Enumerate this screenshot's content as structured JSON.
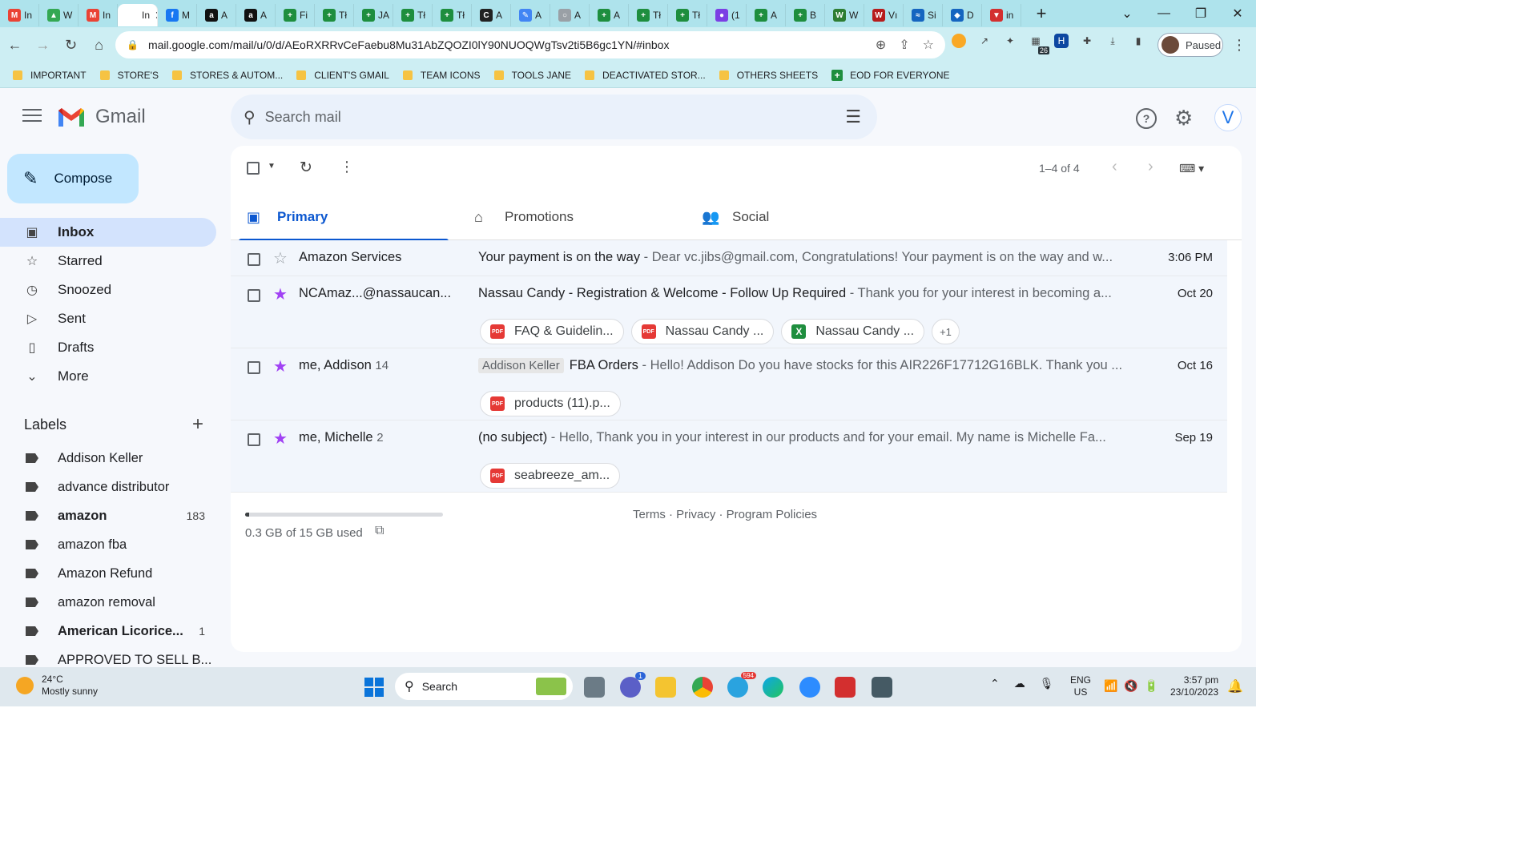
{
  "browser": {
    "tabs": [
      {
        "label": "In",
        "color": "#ea4335",
        "glyph": "M"
      },
      {
        "label": "W",
        "color": "#34a853",
        "glyph": "▲"
      },
      {
        "label": "In",
        "color": "#ea4335",
        "glyph": "M"
      },
      {
        "label": "In",
        "color": "#ffffff",
        "glyph": ""
      },
      {
        "label": "M",
        "color": "#1877f2",
        "glyph": "f"
      },
      {
        "label": "A",
        "color": "#111111",
        "glyph": "a"
      },
      {
        "label": "A",
        "color": "#111111",
        "glyph": "a"
      },
      {
        "label": "Fi",
        "color": "#1e8e3e",
        "glyph": "+"
      },
      {
        "label": "Tł",
        "color": "#1e8e3e",
        "glyph": "+"
      },
      {
        "label": "JA",
        "color": "#1e8e3e",
        "glyph": "+"
      },
      {
        "label": "Tł",
        "color": "#1e8e3e",
        "glyph": "+"
      },
      {
        "label": "Tł",
        "color": "#1e8e3e",
        "glyph": "+"
      },
      {
        "label": "A",
        "color": "#222222",
        "glyph": "C"
      },
      {
        "label": "A",
        "color": "#4285f4",
        "glyph": "✎"
      },
      {
        "label": "A",
        "color": "#9aa0a6",
        "glyph": "○"
      },
      {
        "label": "A",
        "color": "#1e8e3e",
        "glyph": "+"
      },
      {
        "label": "Tł",
        "color": "#1e8e3e",
        "glyph": "+"
      },
      {
        "label": "Tł",
        "color": "#1e8e3e",
        "glyph": "+"
      },
      {
        "label": "(1",
        "color": "#7b3fe4",
        "glyph": "●"
      },
      {
        "label": "A",
        "color": "#1e8e3e",
        "glyph": "+"
      },
      {
        "label": "B",
        "color": "#1e8e3e",
        "glyph": "+"
      },
      {
        "label": "W",
        "color": "#2e7d32",
        "glyph": "W"
      },
      {
        "label": "Vı",
        "color": "#b71c1c",
        "glyph": "W"
      },
      {
        "label": "Si",
        "color": "#1565c0",
        "glyph": "≈"
      },
      {
        "label": "D",
        "color": "#1565c0",
        "glyph": "◆"
      },
      {
        "label": "in",
        "color": "#d32f2f",
        "glyph": "▼"
      }
    ],
    "active_tab_index": 3,
    "new_tab_label": "+",
    "url": "mail.google.com/mail/u/0/d/AEoRXRRvCeFaebu8Mu31AbZQOZI0lY90NUOQWgTsv2ti5B6gc1YN/#inbox",
    "profile_status": "Paused",
    "extension_badge": "26",
    "bookmarks": [
      {
        "label": "IMPORTANT",
        "type": "folder"
      },
      {
        "label": "STORE'S",
        "type": "folder"
      },
      {
        "label": "STORES & AUTOM...",
        "type": "folder"
      },
      {
        "label": "CLIENT'S GMAIL",
        "type": "folder"
      },
      {
        "label": "TEAM ICONS",
        "type": "folder"
      },
      {
        "label": "TOOLS JANE",
        "type": "folder"
      },
      {
        "label": "DEACTIVATED STOR...",
        "type": "folder"
      },
      {
        "label": "OTHERS SHEETS",
        "type": "folder"
      },
      {
        "label": "EOD FOR EVERYONE",
        "type": "sheet"
      }
    ]
  },
  "gmail": {
    "brand": "Gmail",
    "search_placeholder": "Search mail",
    "avatar_letter": "V",
    "compose_label": "Compose",
    "nav": [
      {
        "label": "Inbox",
        "icon": "inbox-icon",
        "glyph": "▣",
        "active": true
      },
      {
        "label": "Starred",
        "icon": "star-icon",
        "glyph": "☆",
        "active": false
      },
      {
        "label": "Snoozed",
        "icon": "clock-icon",
        "glyph": "◷",
        "active": false
      },
      {
        "label": "Sent",
        "icon": "send-icon",
        "glyph": "▷",
        "active": false
      },
      {
        "label": "Drafts",
        "icon": "draft-icon",
        "glyph": "▯",
        "active": false
      },
      {
        "label": "More",
        "icon": "chevron-down-icon",
        "glyph": "⌄",
        "active": false
      }
    ],
    "labels_title": "Labels",
    "labels": [
      {
        "label": "Addison Keller",
        "bold": false,
        "count": ""
      },
      {
        "label": "advance distributor",
        "bold": false,
        "count": ""
      },
      {
        "label": "amazon",
        "bold": true,
        "count": "183"
      },
      {
        "label": "amazon fba",
        "bold": false,
        "count": ""
      },
      {
        "label": "Amazon Refund",
        "bold": false,
        "count": ""
      },
      {
        "label": "amazon removal",
        "bold": false,
        "count": ""
      },
      {
        "label": "American Licorice...",
        "bold": true,
        "count": "1"
      },
      {
        "label": "APPROVED TO SELL B...",
        "bold": false,
        "count": ""
      }
    ],
    "pager": "1–4 of 4",
    "category_tabs": [
      {
        "label": "Primary",
        "icon": "inbox-icon",
        "glyph": "▣",
        "active": true
      },
      {
        "label": "Promotions",
        "icon": "tag-icon",
        "glyph": "⌂",
        "active": false
      },
      {
        "label": "Social",
        "icon": "people-icon",
        "glyph": "👥",
        "active": false
      }
    ],
    "emails": [
      {
        "sender": "Amazon Services",
        "count": "",
        "starred": false,
        "label": "",
        "subject": "Your payment is on the way",
        "snippet": " - Dear vc.jibs@gmail.com, Congratulations! Your payment is on the way and w...",
        "date": "3:06 PM",
        "attachments": []
      },
      {
        "sender": "NCAmaz...@nassaucan...",
        "count": "",
        "starred": true,
        "label": "",
        "subject": "Nassau Candy - Registration & Welcome - Follow Up Required",
        "snippet": " - Thank you for your interest in becoming a...",
        "date": "Oct 20",
        "attachments": [
          {
            "name": "FAQ & Guidelin...",
            "type": "pdf"
          },
          {
            "name": "Nassau Candy ...",
            "type": "pdf"
          },
          {
            "name": "Nassau Candy ...",
            "type": "xls"
          }
        ],
        "more_attachments": "+1"
      },
      {
        "sender": "me, Addison",
        "count": "14",
        "starred": true,
        "label": "Addison Keller",
        "subject": "FBA Orders",
        "snippet": " - Hello! Addison Do you have stocks for this AIR226F17712G16BLK. Thank you ...",
        "date": "Oct 16",
        "attachments": [
          {
            "name": "products (11).p...",
            "type": "pdf"
          }
        ]
      },
      {
        "sender": "me, Michelle",
        "count": "2",
        "starred": true,
        "label": "",
        "subject": "(no subject)",
        "snippet": " - Hello, Thank you in your interest in our products and for your email. My name is Michelle Fa...",
        "date": "Sep 19",
        "attachments": [
          {
            "name": "seabreeze_am...",
            "type": "pdf"
          }
        ]
      }
    ],
    "storage_text": "0.3 GB of 15 GB used",
    "storage_fraction": 0.02,
    "footer_links": "Terms · Privacy · Program Policies"
  },
  "taskbar": {
    "weather_temp": "24°C",
    "weather_desc": "Mostly sunny",
    "search_label": "Search",
    "telegram_badge": "594",
    "teams_badge": "1",
    "lang_top": "ENG",
    "lang_bottom": "US",
    "time": "3:57 pm",
    "date": "23/10/2023"
  }
}
